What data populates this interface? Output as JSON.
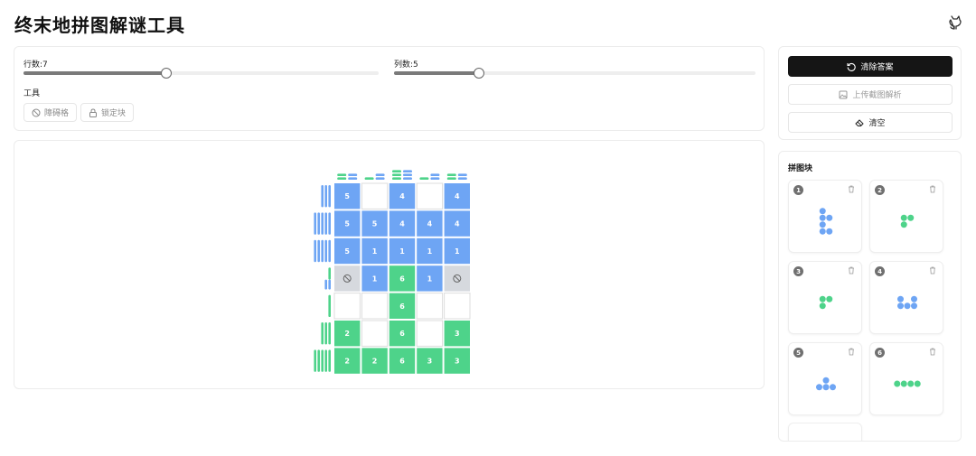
{
  "app": {
    "title": "终末地拼图解谜工具"
  },
  "controls": {
    "rows_label": "行数:7",
    "rows_value": 7,
    "cols_label": "列数:5",
    "cols_value": 5,
    "tools_label": "工具",
    "tools": [
      {
        "label": "障碍格",
        "icon": "ban-icon"
      },
      {
        "label": "锁定块",
        "icon": "lock-icon"
      }
    ]
  },
  "actions": {
    "clear_answer": "清除答案",
    "upload": "上传截图解析",
    "clear_all": "清空"
  },
  "pieces_panel": {
    "title": "拼图块"
  },
  "colors": {
    "blue": "#6ea5f4",
    "green": "#4ed38a",
    "obstacle": "#d6d9de",
    "empty": "#ffffff",
    "dark_button": "#151515"
  },
  "grid": {
    "rows": 7,
    "cols": 5,
    "cells": [
      [
        {
          "c": "b",
          "n": "5"
        },
        {
          "c": "e",
          "n": ""
        },
        {
          "c": "b",
          "n": "4"
        },
        {
          "c": "e",
          "n": ""
        },
        {
          "c": "b",
          "n": "4"
        }
      ],
      [
        {
          "c": "b",
          "n": "5"
        },
        {
          "c": "b",
          "n": "5"
        },
        {
          "c": "b",
          "n": "4"
        },
        {
          "c": "b",
          "n": "4"
        },
        {
          "c": "b",
          "n": "4"
        }
      ],
      [
        {
          "c": "b",
          "n": "5"
        },
        {
          "c": "b",
          "n": "1"
        },
        {
          "c": "b",
          "n": "1"
        },
        {
          "c": "b",
          "n": "1"
        },
        {
          "c": "b",
          "n": "1"
        }
      ],
      [
        {
          "c": "x",
          "n": ""
        },
        {
          "c": "b",
          "n": "1"
        },
        {
          "c": "g",
          "n": "6"
        },
        {
          "c": "b",
          "n": "1"
        },
        {
          "c": "x",
          "n": ""
        }
      ],
      [
        {
          "c": "e",
          "n": ""
        },
        {
          "c": "e",
          "n": ""
        },
        {
          "c": "g",
          "n": "6"
        },
        {
          "c": "e",
          "n": ""
        },
        {
          "c": "e",
          "n": ""
        }
      ],
      [
        {
          "c": "g",
          "n": "2"
        },
        {
          "c": "e",
          "n": ""
        },
        {
          "c": "g",
          "n": "6"
        },
        {
          "c": "e",
          "n": ""
        },
        {
          "c": "g",
          "n": "3"
        }
      ],
      [
        {
          "c": "g",
          "n": "2"
        },
        {
          "c": "g",
          "n": "2"
        },
        {
          "c": "g",
          "n": "6"
        },
        {
          "c": "g",
          "n": "3"
        },
        {
          "c": "g",
          "n": "3"
        }
      ]
    ],
    "col_hints": [
      [
        {
          "c": "g",
          "v": 2
        },
        {
          "c": "b",
          "v": 2
        }
      ],
      [
        {
          "c": "g",
          "v": 1
        },
        {
          "c": "b",
          "v": 2
        }
      ],
      [
        {
          "c": "g",
          "v": 3
        },
        {
          "c": "b",
          "v": 3
        }
      ],
      [
        {
          "c": "g",
          "v": 1
        },
        {
          "c": "b",
          "v": 2
        }
      ],
      [
        {
          "c": "g",
          "v": 2
        },
        {
          "c": "b",
          "v": 2
        }
      ]
    ],
    "row_hints": [
      [
        {
          "c": "b",
          "v": 3
        }
      ],
      [
        {
          "c": "b",
          "v": 5
        }
      ],
      [
        {
          "c": "b",
          "v": 5
        }
      ],
      [
        {
          "c": "g",
          "v": 1
        },
        {
          "c": "b",
          "v": 2
        }
      ],
      [
        {
          "c": "g",
          "v": 1
        }
      ],
      [
        {
          "c": "g",
          "v": 3
        }
      ],
      [
        {
          "c": "g",
          "v": 5
        }
      ]
    ]
  },
  "pieces": [
    {
      "id": "1",
      "color": "b",
      "cells": [
        [
          0,
          0
        ],
        [
          1,
          0
        ],
        [
          1,
          1
        ],
        [
          2,
          0
        ],
        [
          3,
          0
        ],
        [
          3,
          1
        ]
      ]
    },
    {
      "id": "2",
      "color": "g",
      "cells": [
        [
          0,
          0
        ],
        [
          0,
          1
        ],
        [
          1,
          0
        ]
      ]
    },
    {
      "id": "3",
      "color": "g",
      "cells": [
        [
          0,
          0
        ],
        [
          0,
          1
        ],
        [
          1,
          0
        ]
      ]
    },
    {
      "id": "4",
      "color": "b",
      "cells": [
        [
          0,
          0
        ],
        [
          0,
          2
        ],
        [
          1,
          0
        ],
        [
          1,
          1
        ],
        [
          1,
          2
        ]
      ]
    },
    {
      "id": "5",
      "color": "b",
      "cells": [
        [
          0,
          1
        ],
        [
          1,
          0
        ],
        [
          1,
          1
        ],
        [
          1,
          2
        ]
      ]
    },
    {
      "id": "6",
      "color": "g",
      "cells": [
        [
          0,
          0
        ],
        [
          0,
          1
        ],
        [
          0,
          2
        ],
        [
          0,
          3
        ]
      ]
    }
  ]
}
